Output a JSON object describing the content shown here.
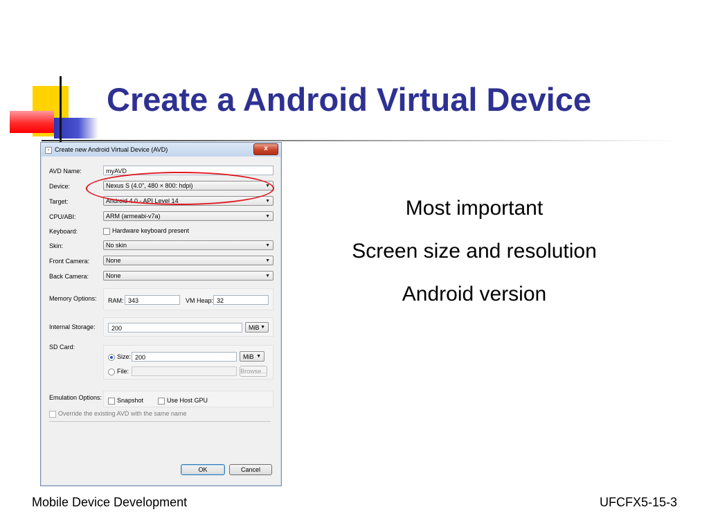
{
  "slide": {
    "title": "Create a Android Virtual Device",
    "bullets": [
      "Most important",
      "Screen size and resolution",
      "Android version"
    ],
    "footer_left": "Mobile Device Development",
    "footer_right": "UFCFX5-15-3"
  },
  "dialog": {
    "title": "Create new Android Virtual Device (AVD)",
    "close_label": "x",
    "fields": {
      "avd_name": {
        "label": "AVD Name:",
        "value": "myAVD"
      },
      "device": {
        "label": "Device:",
        "value": "Nexus S (4.0\", 480 × 800: hdpi)"
      },
      "target": {
        "label": "Target:",
        "value": "Android 4.0 - API Level 14"
      },
      "cpu_abi": {
        "label": "CPU/ABI:",
        "value": "ARM (armeabi-v7a)"
      },
      "keyboard": {
        "label": "Keyboard:",
        "checkbox_label": "Hardware keyboard present"
      },
      "skin": {
        "label": "Skin:",
        "value": "No skin"
      },
      "front_camera": {
        "label": "Front Camera:",
        "value": "None"
      },
      "back_camera": {
        "label": "Back Camera:",
        "value": "None"
      }
    },
    "memory": {
      "label": "Memory Options:",
      "ram_label": "RAM:",
      "ram_value": "343",
      "vm_heap_label": "VM Heap:",
      "vm_heap_value": "32"
    },
    "internal_storage": {
      "label": "Internal Storage:",
      "value": "200",
      "unit": "MiB"
    },
    "sd_card": {
      "label": "SD Card:",
      "size_label": "Size:",
      "size_value": "200",
      "size_unit": "MiB",
      "file_label": "File:",
      "browse_label": "Browse..."
    },
    "emulation": {
      "label": "Emulation Options:",
      "snapshot_label": "Snapshot",
      "host_gpu_label": "Use Host GPU"
    },
    "override_label": "Override the existing AVD with the same name",
    "ok_label": "OK",
    "cancel_label": "Cancel"
  },
  "colors": {
    "title": "#2e3192",
    "annotation": "#e0141e"
  }
}
